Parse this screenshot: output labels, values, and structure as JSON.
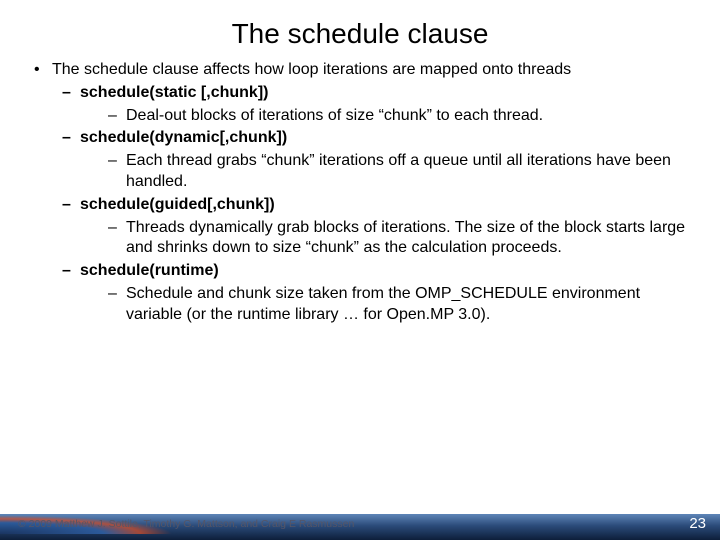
{
  "title": "The schedule clause",
  "intro": "The schedule clause affects how loop iterations are mapped onto threads",
  "items": [
    {
      "head": "schedule(static [,chunk])",
      "desc": "Deal-out blocks of iterations of size “chunk” to each thread."
    },
    {
      "head": "schedule(dynamic[,chunk])",
      "desc": "Each thread grabs “chunk” iterations off a queue until all iterations have been handled."
    },
    {
      "head": "schedule(guided[,chunk])",
      "desc": "Threads dynamically grab blocks of iterations. The size of the block starts large and shrinks down to size “chunk” as the calculation proceeds."
    },
    {
      "head": "schedule(runtime)",
      "desc": "Schedule  and chunk size taken from the OMP_SCHEDULE environment variable (or the runtime library … for Open.MP 3.0)."
    }
  ],
  "copyright": "© 2009 Matthew J. Sottile, Timothy G. Mattson, and Craig E Rasmussen",
  "page": "23"
}
